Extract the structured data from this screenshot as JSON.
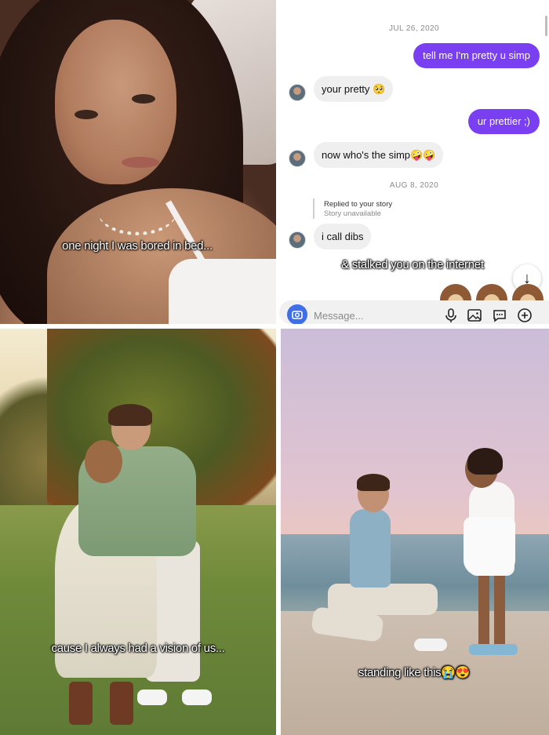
{
  "panel1": {
    "caption": "one night I was bored in bed..."
  },
  "chat": {
    "date1": "JUL 26, 2020",
    "date2": "AUG 8, 2020",
    "messages": [
      {
        "from": "me",
        "text": "tell me I'm pretty u simp"
      },
      {
        "from": "them",
        "text": "your pretty 🥺"
      },
      {
        "from": "me",
        "text": "ur prettier ;)"
      },
      {
        "from": "them",
        "text": "now who's the simp🤪🤪"
      },
      {
        "from": "them",
        "text": "i call dibs"
      }
    ],
    "reply_title": "Replied to your story",
    "reply_sub": "Story unavailable",
    "overlay_caption": "& stalked you on the internet",
    "composer_placeholder": "Message...",
    "scroll_arrow": "↓",
    "composer_icons": [
      "mic-icon",
      "gallery-icon",
      "sticker-icon",
      "add-icon"
    ],
    "accent_color": "#7b3ff2"
  },
  "panel3": {
    "caption": "cause I always had a vision of us..."
  },
  "panel4": {
    "caption": "standing like this😭😍"
  }
}
